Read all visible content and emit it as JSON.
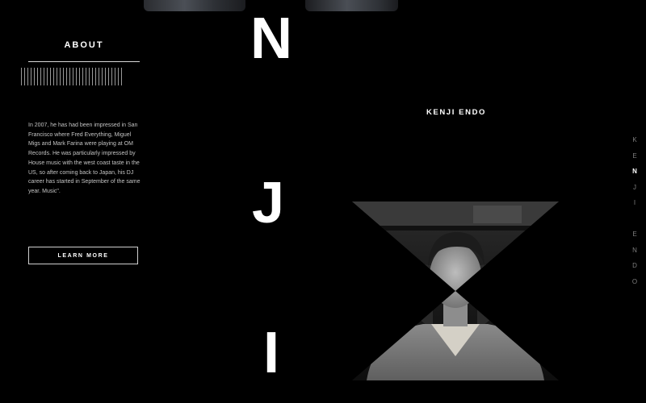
{
  "about": {
    "title": "ABOUT",
    "body": "In 2007, he has had been impressed in San Francisco where Fred Everything, Miguel Migs and Mark Farina were playing at OM Records. He was particularly impressed by House music with the west coast taste in the US, so after coming back to Japan, his DJ career has started in September of the same year. Music\".",
    "button_label": "LEARN MORE"
  },
  "big_letters": [
    "N",
    "J",
    "I"
  ],
  "artist": {
    "name": "KENJI ENDO",
    "photo_icon": "artist-portrait"
  },
  "side_nav": {
    "letters": [
      "K",
      "E",
      "N",
      "J",
      "I",
      "",
      "E",
      "N",
      "D",
      "O"
    ],
    "active_index": 2
  }
}
